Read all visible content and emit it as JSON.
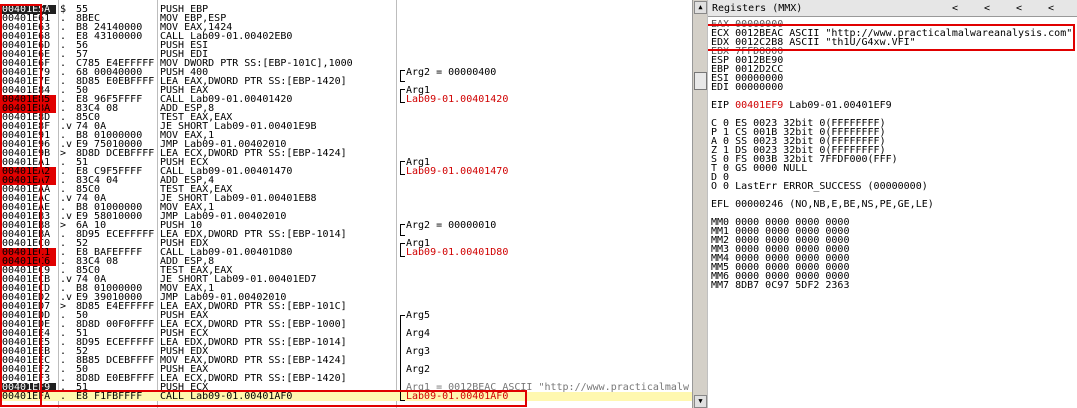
{
  "cpu_rows": [
    {
      "addr": "00401E5A",
      "bp": "cur",
      "mark": "$",
      "hex": "55",
      "dis": "PUSH EBP",
      "cmt": ""
    },
    {
      "addr": "00401E61",
      "bp": "",
      "mark": ".",
      "hex": "8BEC",
      "dis": "MOV EBP,ESP",
      "cmt": ""
    },
    {
      "addr": "00401E63",
      "bp": "",
      "mark": ".",
      "hex": "B8 24140000",
      "dis": "MOV EAX,1424",
      "cmt": ""
    },
    {
      "addr": "00401E68",
      "bp": "",
      "mark": ".",
      "hex": "E8 43100000",
      "dis": "CALL Lab09-01.00402EB0",
      "cmt": ""
    },
    {
      "addr": "00401E6D",
      "bp": "",
      "mark": ".",
      "hex": "56",
      "dis": "PUSH ESI",
      "cmt": ""
    },
    {
      "addr": "00401E6E",
      "bp": "",
      "mark": ".",
      "hex": "57",
      "dis": "PUSH EDI",
      "cmt": ""
    },
    {
      "addr": "00401E6F",
      "bp": "",
      "mark": ".",
      "hex": "C785 E4EFFFFF",
      "dis": "MOV DWORD PTR SS:[EBP-101C],1000",
      "cmt": ""
    },
    {
      "addr": "00401E79",
      "bp": "",
      "mark": ".",
      "hex": "68 00040000",
      "dis": "PUSH 400",
      "cmt": "Arg2 = 00000400"
    },
    {
      "addr": "00401E7E",
      "bp": "",
      "mark": ".",
      "hex": "8D85 E0EBFFFF",
      "dis": "LEA EAX,DWORD PTR SS:[EBP-1420]",
      "cmt": ""
    },
    {
      "addr": "00401E84",
      "bp": "",
      "mark": ".",
      "hex": "50",
      "dis": "PUSH EAX",
      "cmt": "Arg1"
    },
    {
      "addr": "00401E85",
      "bp": "bp",
      "mark": ".",
      "hex": "E8 96F5FFFF",
      "dis": "CALL Lab09-01.00401420",
      "cmt": "Lab09-01.00401420",
      "cmtred": true
    },
    {
      "addr": "00401E8A",
      "bp": "bp",
      "mark": ".",
      "hex": "83C4 08",
      "dis": "ADD ESP,8",
      "cmt": ""
    },
    {
      "addr": "00401E8D",
      "bp": "",
      "mark": ".",
      "hex": "85C0",
      "dis": "TEST EAX,EAX",
      "cmt": ""
    },
    {
      "addr": "00401E8F",
      "bp": "",
      "mark": ".v",
      "hex": "74 0A",
      "dis": "JE SHORT Lab09-01.00401E9B",
      "cmt": ""
    },
    {
      "addr": "00401E91",
      "bp": "",
      "mark": ".",
      "hex": "B8 01000000",
      "dis": "MOV EAX,1",
      "cmt": ""
    },
    {
      "addr": "00401E96",
      "bp": "",
      "mark": ".v",
      "hex": "E9 75010000",
      "dis": "JMP Lab09-01.00402010",
      "cmt": ""
    },
    {
      "addr": "00401E9B",
      "bp": "",
      "mark": ">",
      "hex": "8D8D DCEBFFFF",
      "dis": "LEA ECX,DWORD PTR SS:[EBP-1424]",
      "cmt": ""
    },
    {
      "addr": "00401EA1",
      "bp": "",
      "mark": ".",
      "hex": "51",
      "dis": "PUSH ECX",
      "cmt": "Arg1"
    },
    {
      "addr": "00401EA2",
      "bp": "bp",
      "mark": ".",
      "hex": "E8 C9F5FFFF",
      "dis": "CALL Lab09-01.00401470",
      "cmt": "Lab09-01.00401470",
      "cmtred": true
    },
    {
      "addr": "00401EA7",
      "bp": "bp",
      "mark": ".",
      "hex": "83C4 04",
      "dis": "ADD ESP,4",
      "cmt": ""
    },
    {
      "addr": "00401EAA",
      "bp": "",
      "mark": ".",
      "hex": "85C0",
      "dis": "TEST EAX,EAX",
      "cmt": ""
    },
    {
      "addr": "00401EAC",
      "bp": "",
      "mark": ".v",
      "hex": "74 0A",
      "dis": "JE SHORT Lab09-01.00401EB8",
      "cmt": ""
    },
    {
      "addr": "00401EAE",
      "bp": "",
      "mark": ".",
      "hex": "B8 01000000",
      "dis": "MOV EAX,1",
      "cmt": ""
    },
    {
      "addr": "00401EB3",
      "bp": "",
      "mark": ".v",
      "hex": "E9 58010000",
      "dis": "JMP Lab09-01.00402010",
      "cmt": ""
    },
    {
      "addr": "00401EB8",
      "bp": "",
      "mark": ">",
      "hex": "6A 10",
      "dis": "PUSH 10",
      "cmt": "Arg2 = 00000010"
    },
    {
      "addr": "00401EBA",
      "bp": "",
      "mark": ".",
      "hex": "8D95 ECEFFFFF",
      "dis": "LEA EDX,DWORD PTR SS:[EBP-1014]",
      "cmt": ""
    },
    {
      "addr": "00401EC0",
      "bp": "",
      "mark": ".",
      "hex": "52",
      "dis": "PUSH EDX",
      "cmt": "Arg1"
    },
    {
      "addr": "00401EC1",
      "bp": "bp",
      "mark": ".",
      "hex": "E8 BAFEFFFF",
      "dis": "CALL Lab09-01.00401D80",
      "cmt": "Lab09-01.00401D80",
      "cmtred": true
    },
    {
      "addr": "00401EC6",
      "bp": "bp",
      "mark": ".",
      "hex": "83C4 08",
      "dis": "ADD ESP,8",
      "cmt": ""
    },
    {
      "addr": "00401EC9",
      "bp": "",
      "mark": ".",
      "hex": "85C0",
      "dis": "TEST EAX,EAX",
      "cmt": ""
    },
    {
      "addr": "00401ECB",
      "bp": "",
      "mark": ".v",
      "hex": "74 0A",
      "dis": "JE SHORT Lab09-01.00401ED7",
      "cmt": ""
    },
    {
      "addr": "00401ECD",
      "bp": "",
      "mark": ".",
      "hex": "B8 01000000",
      "dis": "MOV EAX,1",
      "cmt": ""
    },
    {
      "addr": "00401ED2",
      "bp": "",
      "mark": ".v",
      "hex": "E9 39010000",
      "dis": "JMP Lab09-01.00402010",
      "cmt": ""
    },
    {
      "addr": "00401ED7",
      "bp": "",
      "mark": ">",
      "hex": "8D85 E4EFFFFF",
      "dis": "LEA EAX,DWORD PTR SS:[EBP-101C]",
      "cmt": ""
    },
    {
      "addr": "00401EDD",
      "bp": "",
      "mark": ".",
      "hex": "50",
      "dis": "PUSH EAX",
      "cmt": "Arg5"
    },
    {
      "addr": "00401EDE",
      "bp": "",
      "mark": ".",
      "hex": "8D8D 00F0FFFF",
      "dis": "LEA ECX,DWORD PTR SS:[EBP-1000]",
      "cmt": ""
    },
    {
      "addr": "00401EE4",
      "bp": "",
      "mark": ".",
      "hex": "51",
      "dis": "PUSH ECX",
      "cmt": "Arg4"
    },
    {
      "addr": "00401EE5",
      "bp": "",
      "mark": ".",
      "hex": "8D95 ECEFFFFF",
      "dis": "LEA EDX,DWORD PTR SS:[EBP-1014]",
      "cmt": ""
    },
    {
      "addr": "00401EEB",
      "bp": "",
      "mark": ".",
      "hex": "52",
      "dis": "PUSH EDX",
      "cmt": "Arg3"
    },
    {
      "addr": "00401EEC",
      "bp": "",
      "mark": ".",
      "hex": "8B85 DCEBFFFF",
      "dis": "MOV EAX,DWORD PTR SS:[EBP-1424]",
      "cmt": ""
    },
    {
      "addr": "00401EF2",
      "bp": "",
      "mark": ".",
      "hex": "50",
      "dis": "PUSH EAX",
      "cmt": "Arg2"
    },
    {
      "addr": "00401EF3",
      "bp": "",
      "mark": ".",
      "hex": "8D8D E0EBFFFF",
      "dis": "LEA ECX,DWORD PTR SS:[EBP-1420]",
      "cmt": ""
    },
    {
      "addr": "00401EF9",
      "bp": "cur",
      "mark": ".",
      "hex": "51",
      "dis": "PUSH ECX",
      "cmt": "Arg1 = 0012BEAC ASCII \"http://www.practicalmalw",
      "cmtgray": true
    },
    {
      "addr": "00401EFA",
      "bp": "",
      "mark": ".",
      "hex": "E8 F1FBFFFF",
      "dis": "CALL Lab09-01.00401AF0",
      "cmt": "Lab09-01.00401AF0",
      "cmtred": true,
      "sel": true
    }
  ],
  "registers": {
    "title": "Registers (MMX)",
    "nav": [
      "<",
      "<",
      "<",
      "<"
    ],
    "lines": [
      {
        "t": "EAX 00000000",
        "cls": "dim"
      },
      {
        "t": "ECX 0012BEAC ASCII \"http://www.practicalmalwareanalysis.com\""
      },
      {
        "t": "EDX 0012C2B8 ASCII \"th1U/G4xw.VFI\""
      },
      {
        "t": "EBX 7FFD8000",
        "cls": "dim"
      },
      {
        "t": "ESP 0012BE90"
      },
      {
        "t": "EBP 0012D2CC"
      },
      {
        "t": "ESI 00000000"
      },
      {
        "t": "EDI 00000000"
      },
      {
        "t": ""
      },
      {
        "t": "EIP 00401EF9 Lab09-01.00401EF9",
        "eip": true
      },
      {
        "t": ""
      },
      {
        "t": "C 0  ES 0023 32bit 0(FFFFFFFF)"
      },
      {
        "t": "P 1  CS 001B 32bit 0(FFFFFFFF)"
      },
      {
        "t": "A 0  SS 0023 32bit 0(FFFFFFFF)"
      },
      {
        "t": "Z 1  DS 0023 32bit 0(FFFFFFFF)"
      },
      {
        "t": "S 0  FS 003B 32bit 7FFDF000(FFF)"
      },
      {
        "t": "T 0  GS 0000 NULL"
      },
      {
        "t": "D 0"
      },
      {
        "t": "O 0  LastErr ERROR_SUCCESS (00000000)"
      },
      {
        "t": ""
      },
      {
        "t": "EFL 00000246 (NO,NB,E,BE,NS,PE,GE,LE)"
      },
      {
        "t": ""
      },
      {
        "t": "MM0 0000 0000 0000 0000"
      },
      {
        "t": "MM1 0000 0000 0000 0000"
      },
      {
        "t": "MM2 0000 0000 0000 0000"
      },
      {
        "t": "MM3 0000 0000 0000 0000"
      },
      {
        "t": "MM4 0000 0000 0000 0000"
      },
      {
        "t": "MM5 0000 0000 0000 0000"
      },
      {
        "t": "MM6 0000 0000 0000 0000"
      },
      {
        "t": "MM7 8DB7 0C97 5DF2 2363"
      }
    ]
  },
  "colors": {
    "breakpoint": "#e00000",
    "highlight": "#e00000",
    "selected_row": "#fff8b0"
  }
}
